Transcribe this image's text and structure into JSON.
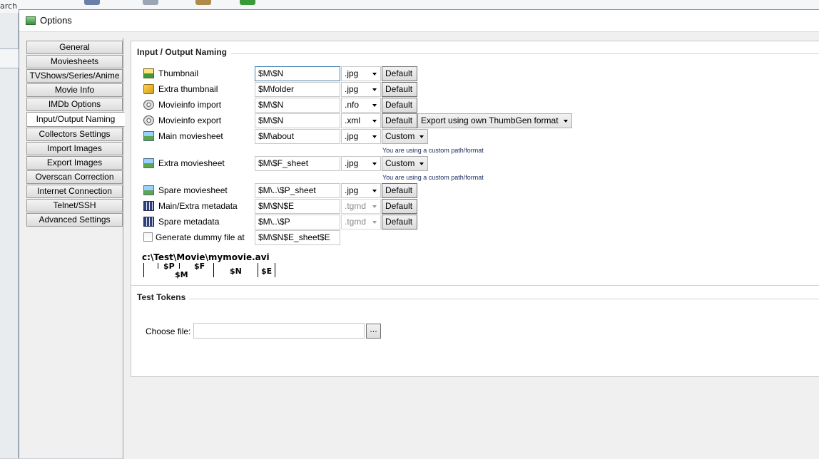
{
  "background_app": {
    "left_text": "arch"
  },
  "window": {
    "title": "Options"
  },
  "tabs": [
    {
      "label": "General",
      "active": false
    },
    {
      "label": "Moviesheets",
      "active": false
    },
    {
      "label": "TVShows/Series/Anime",
      "active": false
    },
    {
      "label": "Movie Info",
      "active": false
    },
    {
      "label": "IMDb Options",
      "active": false
    },
    {
      "label": "Input/Output Naming",
      "active": true
    },
    {
      "label": "Collectors Settings",
      "active": false
    },
    {
      "label": "Import Images",
      "active": false
    },
    {
      "label": "Export Images",
      "active": false
    },
    {
      "label": "Overscan Correction",
      "active": false
    },
    {
      "label": "Internet Connection",
      "active": false
    },
    {
      "label": "Telnet/SSH",
      "active": false
    },
    {
      "label": "Advanced Settings",
      "active": false
    }
  ],
  "io_naming": {
    "group_title": "Input / Output Naming",
    "rows": [
      {
        "label": "Thumbnail",
        "icon": "thumbnail-image-icon",
        "value": "$M\\$N",
        "ext": ".jpg",
        "action": "Default"
      },
      {
        "label": "Extra thumbnail",
        "icon": "extra-thumbnail-icon",
        "value": "$M\\folder",
        "ext": ".jpg",
        "action": "Default"
      },
      {
        "label": "Movieinfo import",
        "icon": "film-reel-icon",
        "value": "$M\\$N",
        "ext": ".nfo",
        "action": "Default"
      },
      {
        "label": "Movieinfo export",
        "icon": "film-reel-icon",
        "value": "$M\\$N",
        "ext": ".xml",
        "action": "Default",
        "format": "Export using own ThumbGen format"
      },
      {
        "label": "Main moviesheet",
        "icon": "image-icon",
        "value": "$M\\about",
        "ext": ".jpg",
        "action": "Custom",
        "note": "You are using a custom path/format"
      },
      {
        "label": "Extra moviesheet",
        "icon": "image-icon",
        "value": "$M\\$F_sheet",
        "ext": ".jpg",
        "action": "Custom",
        "note": "You are using a custom path/format"
      },
      {
        "label": "Spare moviesheet",
        "icon": "image-icon",
        "value": "$M\\..\\$P_sheet",
        "ext": ".jpg",
        "action": "Default"
      },
      {
        "label": "Main/Extra metadata",
        "icon": "metadata-icon",
        "value": "$M\\$N$E",
        "ext": ".tgmd",
        "action": "Default"
      },
      {
        "label": "Spare metadata",
        "icon": "metadata-icon",
        "value": "$M\\..\\$P",
        "ext": ".tgmd",
        "action": "Default"
      }
    ],
    "dummy": {
      "label": "Generate dummy file at",
      "value": "$M\\$N$E_sheet$E",
      "checked": false
    },
    "diagram": {
      "path": "c:\\Test\\Movie\\mymovie.avi",
      "tokens": {
        "p": "$P",
        "m": "$M",
        "f": "$F",
        "n": "$N",
        "e": "$E"
      }
    }
  },
  "test_tokens": {
    "group_title": "Test Tokens",
    "choose_label": "Choose file:",
    "choose_value": "",
    "browse_label": "..."
  }
}
